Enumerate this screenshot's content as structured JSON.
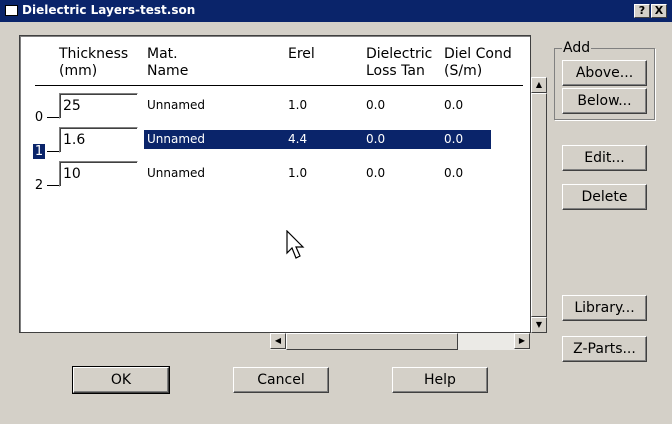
{
  "window": {
    "title": "Dielectric Layers-test.son",
    "help_glyph": "?",
    "close_glyph": "X"
  },
  "table": {
    "headers": [
      {
        "line1": "Thickness",
        "line2": "(mm)"
      },
      {
        "line1": "Mat.",
        "line2": "Name"
      },
      {
        "line1": "Erel",
        "line2": ""
      },
      {
        "line1": "Dielectric",
        "line2": "Loss Tan"
      },
      {
        "line1": "Diel Cond",
        "line2": "(S/m)"
      }
    ],
    "rows": [
      {
        "index": "0",
        "thickness": "25",
        "name": "Unnamed",
        "erel": "1.0",
        "loss_tan": "0.0",
        "diel_cond": "0.0"
      },
      {
        "index": "1",
        "thickness": "1.6",
        "name": "Unnamed",
        "erel": "4.4",
        "loss_tan": "0.0",
        "diel_cond": "0.0"
      },
      {
        "index": "2",
        "thickness": "10",
        "name": "Unnamed",
        "erel": "1.0",
        "loss_tan": "0.0",
        "diel_cond": "0.0"
      }
    ],
    "selected_row": 1
  },
  "add_group": {
    "label": "Add",
    "above_label": "Above...",
    "below_label": "Below..."
  },
  "side_buttons": {
    "edit_label": "Edit...",
    "delete_label": "Delete",
    "library_label": "Library...",
    "zparts_label": "Z-Parts..."
  },
  "footer": {
    "ok_label": "OK",
    "cancel_label": "Cancel",
    "help_label": "Help"
  },
  "scroll_glyphs": {
    "up": "▲",
    "down": "▼",
    "left": "◀",
    "right": "▶"
  },
  "colors": {
    "titlebar": "#0a246a",
    "selection": "#0a246a",
    "face": "#d4d0c8"
  }
}
